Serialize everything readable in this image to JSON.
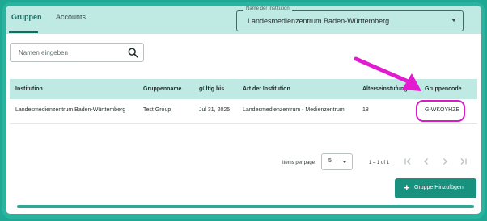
{
  "tabs": [
    {
      "label": "Gruppen",
      "active": true
    },
    {
      "label": "Accounts",
      "active": false
    }
  ],
  "institution_select": {
    "legend": "Name der Institution",
    "value": "Landesmedienzentrum Baden-Württemberg"
  },
  "search": {
    "placeholder": "Namen eingeben"
  },
  "table": {
    "headers": [
      "Institution",
      "Gruppenname",
      "gültig bis",
      "Art der Institution",
      "Alterseinstufung",
      "Gruppencode"
    ],
    "rows": [
      [
        "Landesmedienzentrum Baden-Württemberg",
        "Test Group",
        "Jul 31, 2025",
        "Landesmedienzentrum - Medienzentrum",
        "18",
        "G-WKOYHZE"
      ]
    ]
  },
  "pagination": {
    "items_per_page_label": "Items per page:",
    "items_per_page": "5",
    "range": "1 – 1 of 1"
  },
  "add_button": {
    "label": "Gruppe Hinzufügen"
  },
  "colors": {
    "accent": "#18917f",
    "header_bg": "#bfeae4",
    "highlight": "#d91ac9"
  }
}
